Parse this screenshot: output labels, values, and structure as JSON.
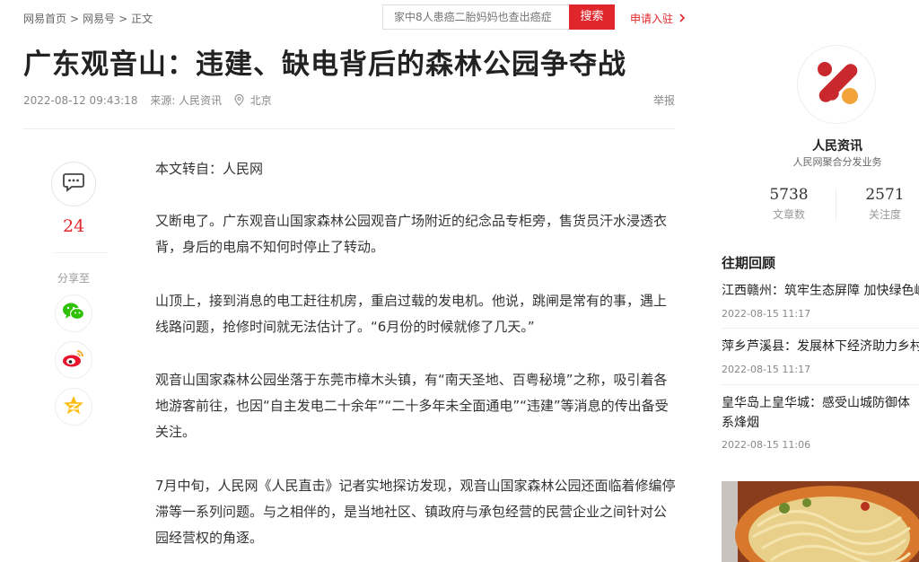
{
  "breadcrumb": [
    "网易首页",
    "网易号",
    "正文"
  ],
  "search": {
    "placeholder": "家中8人患癌二胎妈妈也查出癌症",
    "button": "搜索"
  },
  "apply_link": "申请入驻",
  "article": {
    "title": "广东观音山：违建、缺电背后的森林公园争夺战",
    "datetime": "2022-08-12 09:43:18",
    "source": "来源: 人民资讯",
    "location": "北京",
    "report": "举报",
    "paragraphs": [
      "本文转自：人民网",
      "又断电了。广东观音山国家森林公园观音广场附近的纪念品专柜旁，售货员汗水浸透衣背，身后的电扇不知何时停止了转动。",
      "山顶上，接到消息的电工赶往机房，重启过载的发电机。他说，跳闸是常有的事，遇上线路问题，抢修时间就无法估计了。“6月份的时候就修了几天。”",
      "观音山国家森林公园坐落于东莞市樟木头镇，有“南天圣地、百粤秘境”之称，吸引着各地游客前往，也因“自主发电二十余年”“二十多年未全面通电”“违建”等消息的传出备受关注。",
      "7月中旬，人民网《人民直击》记者实地探访发现，观音山国家森林公园还面临着修编停滞等一系列问题。与之相伴的，是当地社区、镇政府与承包经营的民营企业之间针对公园经营权的角逐。"
    ]
  },
  "share": {
    "comment_count": "24",
    "label": "分享至"
  },
  "author": {
    "name": "人民资讯",
    "desc": "人民网聚合分发业务",
    "articles": "5738",
    "articles_label": "文章数",
    "followers": "2571",
    "followers_label": "关注度"
  },
  "past_review": {
    "title": "往期回顾",
    "items": [
      {
        "title": "江西赣州：筑牢生态屏障 加快绿色崛",
        "time": "2022-08-15 11:17"
      },
      {
        "title": "萍乡芦溪县：发展林下经济助力乡村",
        "time": "2022-08-15 11:17"
      },
      {
        "title": "皇华岛上皇华城：感受山城防御体系烽烟",
        "time": "2022-08-15 11:06"
      }
    ]
  },
  "colors": {
    "accent": "#e0252b",
    "logo_red": "#c9282d",
    "logo_orange": "#f2a33a"
  },
  "icons": [
    "location-icon",
    "comment-icon",
    "wechat-icon",
    "weibo-icon",
    "qzone-icon",
    "chevron-right-icon"
  ]
}
